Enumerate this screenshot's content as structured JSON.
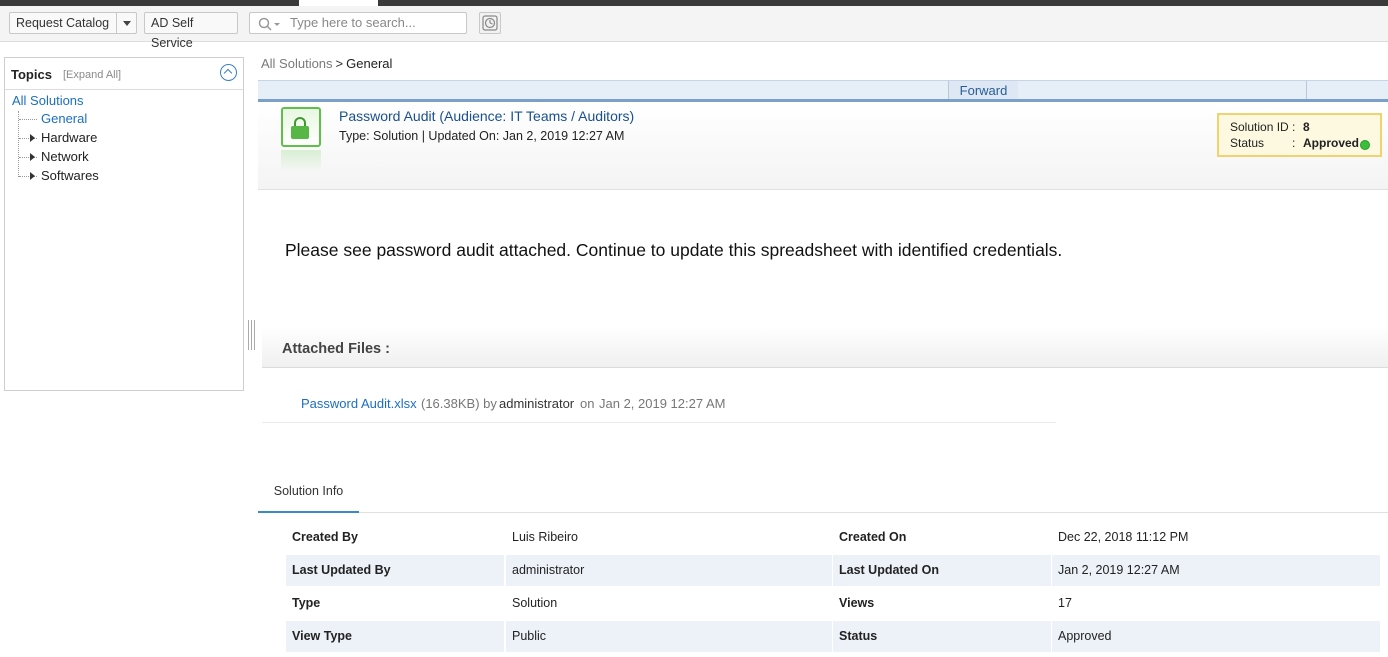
{
  "toolbar": {
    "request_catalog": "Request Catalog",
    "ad_self_service": "AD Self Service",
    "search_placeholder": "Type here to search..."
  },
  "sidebar": {
    "title": "Topics",
    "expand_all": "[Expand All]",
    "root": "All Solutions",
    "items": [
      {
        "label": "General",
        "selected": true,
        "expandable": false
      },
      {
        "label": "Hardware",
        "selected": false,
        "expandable": true
      },
      {
        "label": "Network",
        "selected": false,
        "expandable": true
      },
      {
        "label": "Softwares",
        "selected": false,
        "expandable": true
      }
    ]
  },
  "breadcrumb": {
    "root": "All Solutions",
    "separator": ">",
    "current": "General"
  },
  "actions": {
    "forward": "Forward"
  },
  "solution": {
    "title": "Password Audit (Audience: IT Teams / Auditors)",
    "meta": "Type: Solution | Updated On: Jan 2, 2019 12:27 AM",
    "id_label": "Solution ID",
    "id_value": "8",
    "status_label": "Status",
    "status_value": "Approved",
    "status_color": "#3bbf3b",
    "description": "Please see password audit attached.  Continue to update this spreadsheet with identified credentials."
  },
  "attachments": {
    "title": "Attached Files :",
    "files": [
      {
        "name": "Password Audit.xlsx",
        "size": "(16.38KB)",
        "by": "by",
        "user": "administrator",
        "on": "on",
        "date": "Jan 2, 2019 12:27 AM"
      }
    ]
  },
  "tabs": {
    "solution_info": "Solution Info"
  },
  "info_rows": [
    {
      "k1": "Created By",
      "v1": "Luis Ribeiro",
      "k2": "Created On",
      "v2": "Dec 22, 2018 11:12 PM"
    },
    {
      "k1": "Last Updated By",
      "v1": "administrator",
      "k2": "Last Updated On",
      "v2": "Jan 2, 2019 12:27 AM"
    },
    {
      "k1": "Type",
      "v1": "Solution",
      "k2": "Views",
      "v2": "17"
    },
    {
      "k1": "View Type",
      "v1": "Public",
      "k2": "Status",
      "v2": "Approved"
    }
  ],
  "colors": {
    "link_blue": "#1b6fc2",
    "title_blue": "#1a4f8f",
    "tab_accent": "#3a8ac6",
    "info_box_bg": "#fdf8e0",
    "info_box_border": "#f0d36e"
  }
}
